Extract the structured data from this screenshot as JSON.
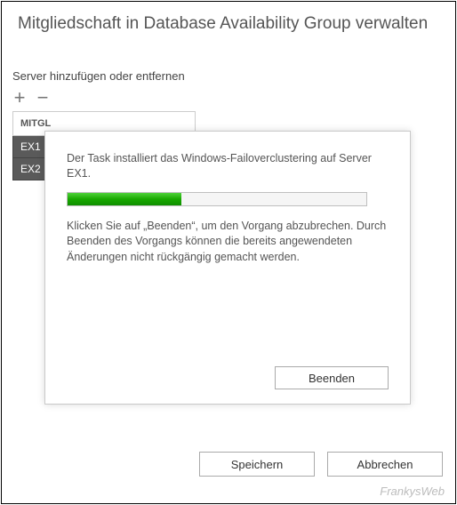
{
  "header": {
    "title": "Mitgliedschaft in Database Availability Group verwalten"
  },
  "section": {
    "subtitle": "Server hinzufügen oder entfernen"
  },
  "toolbar": {
    "add_icon": "+",
    "remove_icon": "−"
  },
  "table": {
    "header": "MITGLIEDSSERVER",
    "header_visible": "MITGL",
    "rows": [
      {
        "name": "EX1"
      },
      {
        "name": "EX2"
      }
    ]
  },
  "modal": {
    "message": "Der Task installiert das Windows-Failoverclustering auf Server EX1.",
    "progress_percent": 38,
    "hint": "Klicken Sie auf „Beenden“, um den Vorgang abzubrechen. Durch Beenden des Vorgangs können die bereits angewendeten Änderungen nicht rückgängig gemacht werden.",
    "cancel_label": "Beenden"
  },
  "footer": {
    "save_label": "Speichern",
    "cancel_label": "Abbrechen"
  },
  "watermark": "FrankysWeb"
}
